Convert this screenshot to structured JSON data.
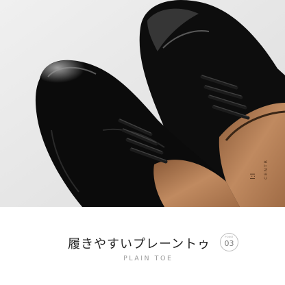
{
  "photo": {
    "subject": "Black patent leather plain-toe derby shoes with tan lining",
    "brand_mark": "I:I",
    "brand_text": "CENTR"
  },
  "caption": {
    "title": "履きやすいプレーントゥ",
    "subtitle": "PLAIN TOE",
    "badge_label": "POINT",
    "badge_number": "03"
  },
  "colors": {
    "background": "#ffffff",
    "photo_bg": "#e9e9e9",
    "leather": "#0c0c0c",
    "lining": "#b57d54"
  }
}
